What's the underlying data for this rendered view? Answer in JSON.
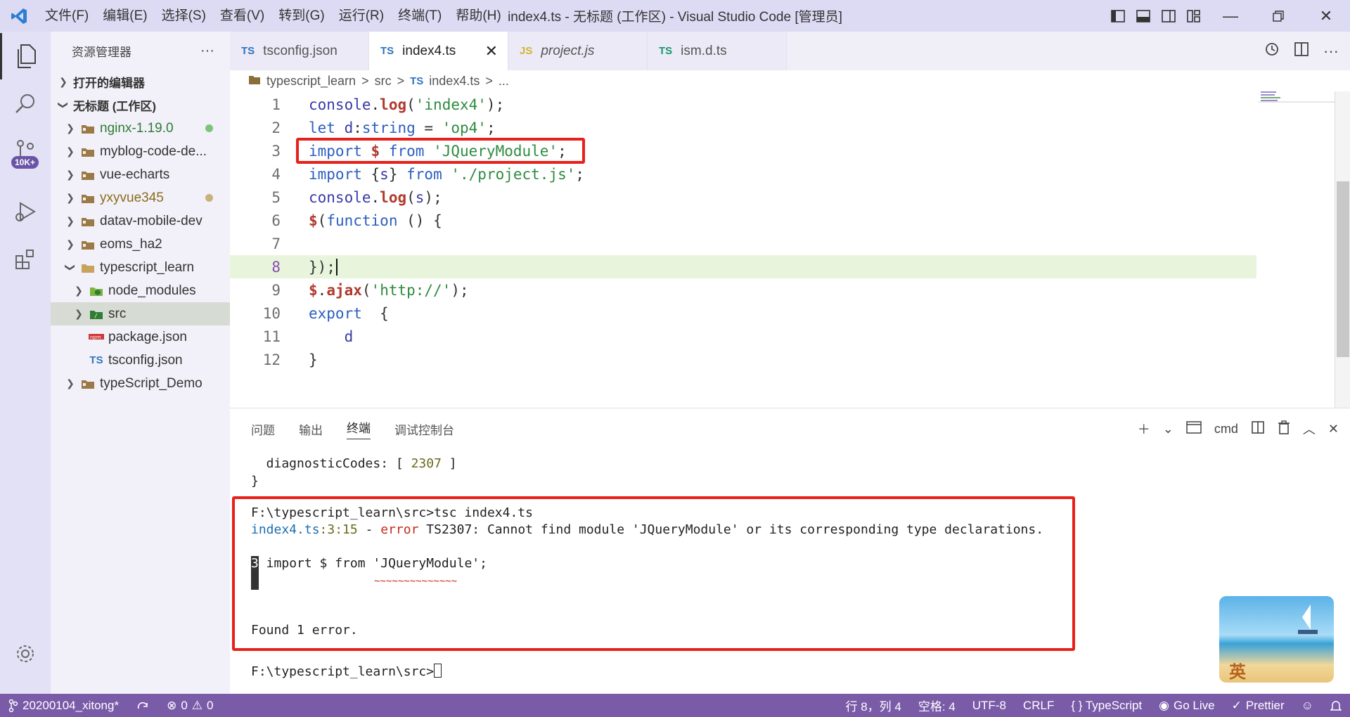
{
  "titlebar": {
    "menu": [
      "文件(F)",
      "编辑(E)",
      "选择(S)",
      "查看(V)",
      "转到(G)",
      "运行(R)",
      "终端(T)",
      "帮助(H)"
    ],
    "title": "index4.ts - 无标题 (工作区) - Visual Studio Code [管理员]"
  },
  "activitybar": {
    "badge": "10K+"
  },
  "sidebar": {
    "header": "资源管理器",
    "more": "···",
    "sections": {
      "open_editors": "打开的编辑器",
      "workspace": "无标题 (工作区)"
    },
    "items": [
      {
        "label": "nginx-1.19.0",
        "color": "#2e7d32",
        "dot": "#7cc47a"
      },
      {
        "label": "myblog-code-de...",
        "color": "#333333"
      },
      {
        "label": "vue-echarts",
        "color": "#333333"
      },
      {
        "label": "yxyvue345",
        "color": "#8a6d1c",
        "dot": "#c9b27a"
      },
      {
        "label": "datav-mobile-dev",
        "color": "#333333"
      },
      {
        "label": "eoms_ha2",
        "color": "#333333"
      },
      {
        "label": "typescript_learn",
        "color": "#333333"
      },
      {
        "label": "node_modules",
        "color": "#333333"
      },
      {
        "label": "src",
        "color": "#333333"
      },
      {
        "label": "package.json",
        "color": "#333333"
      },
      {
        "label": "tsconfig.json",
        "color": "#333333"
      },
      {
        "label": "typeScript_Demo",
        "color": "#333333"
      }
    ]
  },
  "tabs": [
    {
      "lang": "TS",
      "label": "tsconfig.json"
    },
    {
      "lang": "TS",
      "label": "index4.ts",
      "close": "✕"
    },
    {
      "lang": "JS",
      "label": "project.js"
    },
    {
      "lang": "TS",
      "label": "ism.d.ts"
    }
  ],
  "breadcrumb": [
    "typescript_learn",
    ">",
    "src",
    ">",
    "TS",
    "index4.ts",
    ">",
    "..."
  ],
  "code": {
    "line_numbers": [
      "1",
      "2",
      "3",
      "4",
      "5",
      "6",
      "7",
      "8",
      "9",
      "10",
      "11",
      "12"
    ],
    "lines": [
      "console.log('index4');",
      "let d:string = 'op4';",
      "import $ from 'JQueryModule';",
      "import {s} from './project.js';",
      "console.log(s);",
      "$(function () {",
      "",
      "});",
      "$.ajax('http://');",
      "export  {",
      "    d",
      "}"
    ]
  },
  "panel": {
    "tabs": [
      "问题",
      "输出",
      "终端",
      "调试控制台"
    ],
    "shell": "cmd",
    "terminal": {
      "l1": "  diagnosticCodes: [ ",
      "l1_num": "2307",
      "l1_end": " ]",
      "l2": "}",
      "cmd": "F:\\typescript_learn\\src>tsc index4.ts",
      "err_file": "index4.ts",
      "err_pos": ":3:15",
      "err_sep": " - ",
      "err_word": "error",
      "err_msg": " TS2307: Cannot find module 'JQueryModule' or its corresponding type declarations.",
      "src_num": "3",
      "src_line": " import $ from 'JQueryModule';",
      "squiggle": "~~~~~~~~~~~~~~",
      "found": "Found 1 error.",
      "prompt": "F:\\typescript_learn\\src>"
    }
  },
  "ime": {
    "label": "英"
  },
  "statusbar": {
    "branch": "20200104_xitong*",
    "errors": "0",
    "warnings": "0",
    "position": "行 8，列 4",
    "spaces": "空格: 4",
    "encoding": "UTF-8",
    "eol": "CRLF",
    "language": "{ } TypeScript",
    "golive": "Go Live",
    "prettier": "Prettier"
  }
}
